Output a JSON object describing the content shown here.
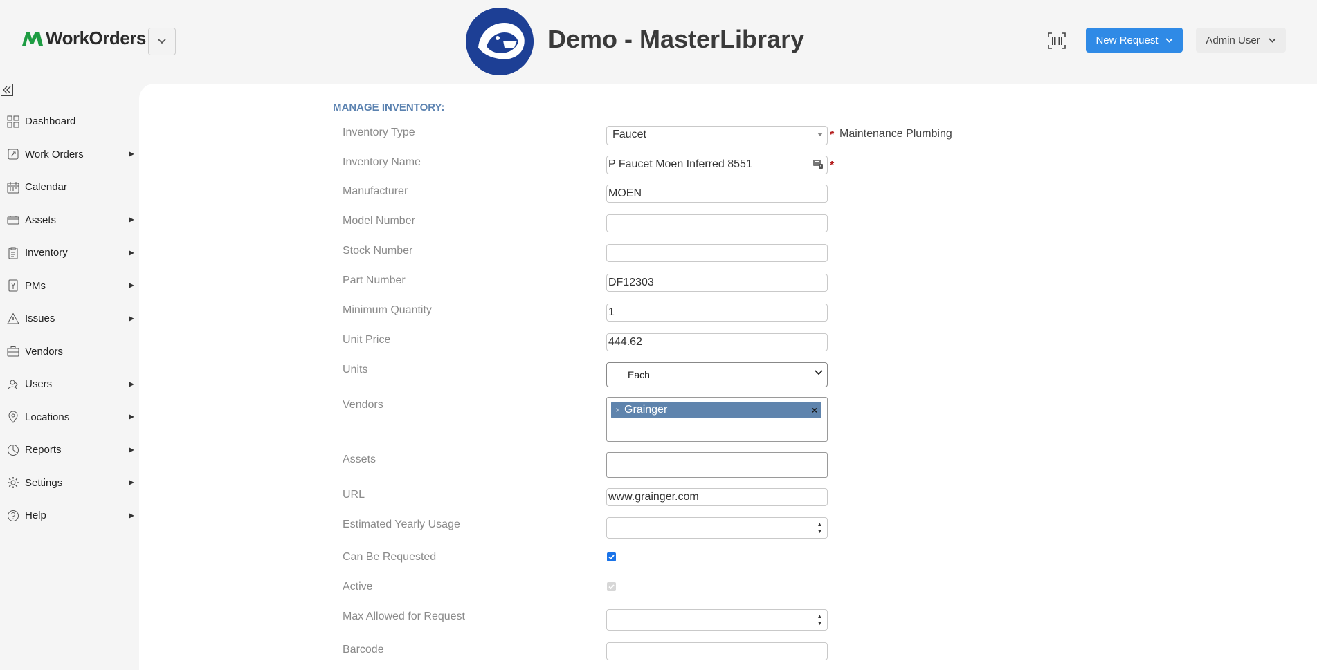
{
  "header": {
    "app_name": "WorkOrders",
    "org_title": "Demo - MasterLibrary",
    "new_request_label": "New Request",
    "user_label": "Admin User"
  },
  "sidebar": {
    "items": [
      {
        "label": "Dashboard",
        "icon": "dashboard-icon",
        "has_submenu": false
      },
      {
        "label": "Work Orders",
        "icon": "work-orders-icon",
        "has_submenu": true
      },
      {
        "label": "Calendar",
        "icon": "calendar-icon",
        "has_submenu": false
      },
      {
        "label": "Assets",
        "icon": "assets-icon",
        "has_submenu": true
      },
      {
        "label": "Inventory",
        "icon": "inventory-icon",
        "has_submenu": true
      },
      {
        "label": "PMs",
        "icon": "pms-icon",
        "has_submenu": true
      },
      {
        "label": "Issues",
        "icon": "warning-icon",
        "has_submenu": true
      },
      {
        "label": "Vendors",
        "icon": "briefcase-icon",
        "has_submenu": false
      },
      {
        "label": "Users",
        "icon": "users-icon",
        "has_submenu": true
      },
      {
        "label": "Locations",
        "icon": "location-pin-icon",
        "has_submenu": true
      },
      {
        "label": "Reports",
        "icon": "reports-icon",
        "has_submenu": true
      },
      {
        "label": "Settings",
        "icon": "gear-icon",
        "has_submenu": true
      },
      {
        "label": "Help",
        "icon": "help-icon",
        "has_submenu": true
      }
    ]
  },
  "form": {
    "section_title": "MANAGE INVENTORY:",
    "inventory_type": {
      "label": "Inventory Type",
      "value": "Faucet",
      "helper": "Maintenance Plumbing"
    },
    "inventory_name": {
      "label": "Inventory Name",
      "value": "P Faucet Moen Inferred 8551"
    },
    "manufacturer": {
      "label": "Manufacturer",
      "value": "MOEN"
    },
    "model_number": {
      "label": "Model Number",
      "value": ""
    },
    "stock_number": {
      "label": "Stock Number",
      "value": ""
    },
    "part_number": {
      "label": "Part Number",
      "value": "DF12303"
    },
    "minimum_quantity": {
      "label": "Minimum Quantity",
      "value": "1"
    },
    "unit_price": {
      "label": "Unit Price",
      "value": "444.62"
    },
    "units": {
      "label": "Units",
      "value": "Each"
    },
    "vendors": {
      "label": "Vendors",
      "tags": [
        "Grainger"
      ]
    },
    "assets": {
      "label": "Assets",
      "value": ""
    },
    "url": {
      "label": "URL",
      "value": "www.grainger.com"
    },
    "estimated_yearly_usage": {
      "label": "Estimated Yearly Usage",
      "value": ""
    },
    "can_be_requested": {
      "label": "Can Be Requested",
      "checked": true
    },
    "active": {
      "label": "Active",
      "checked": true,
      "disabled": true
    },
    "max_allowed_for_request": {
      "label": "Max Allowed for Request",
      "value": ""
    },
    "barcode": {
      "label": "Barcode",
      "value": ""
    }
  },
  "colors": {
    "accent": "#2f8ae6",
    "section_title": "#5b82b0",
    "vendor_tag": "#5f84ad",
    "required": "#b41c1c",
    "logo_green": "#1e9c43"
  }
}
